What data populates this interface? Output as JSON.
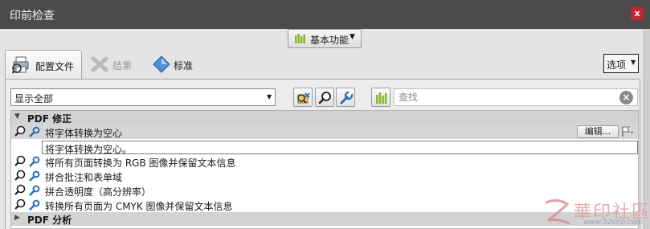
{
  "window": {
    "title": "印前检查",
    "close_label": "x"
  },
  "mode": {
    "label": "基本功能",
    "icon": "bar-chart-icon"
  },
  "tabs": [
    {
      "label": "配置文件",
      "icon": "printer-icon",
      "active": true
    },
    {
      "label": "结果",
      "icon": "wrench-cross-icon",
      "active": false,
      "disabled": true
    },
    {
      "label": "标准",
      "icon": "diamond-icon",
      "active": false
    }
  ],
  "options_button": {
    "label": "选项"
  },
  "profile_select": {
    "value": "显示全部"
  },
  "toolbar": {
    "buttons": [
      "profile-icon",
      "magnifier-icon",
      "wrench-icon",
      "bar-chart-icon"
    ]
  },
  "search": {
    "placeholder": "查找",
    "value": ""
  },
  "sections": [
    {
      "title": "PDF 修正",
      "expanded": true,
      "items": [
        {
          "label": "将字体转换为空心",
          "selected": true,
          "description": "将字体转换为空心。",
          "edit_label": "编辑..."
        },
        {
          "label": "将所有页面转换为 RGB 图像并保留文本信息"
        },
        {
          "label": "拼合批注和表单域"
        },
        {
          "label": "拼合透明度（高分辨率）"
        },
        {
          "label": "转换所有页面为 CMYK 图像并保留文本信息"
        }
      ]
    },
    {
      "title": "PDF 分析",
      "expanded": false,
      "items": []
    }
  ],
  "watermark": {
    "text": "華印社區",
    "url": "www.52cnp.com"
  },
  "colors": {
    "titlebar": "#4b4b4b",
    "close": "#c1272d",
    "accent_green": "#8ab92d",
    "accent_blue": "#2e6fb5"
  }
}
